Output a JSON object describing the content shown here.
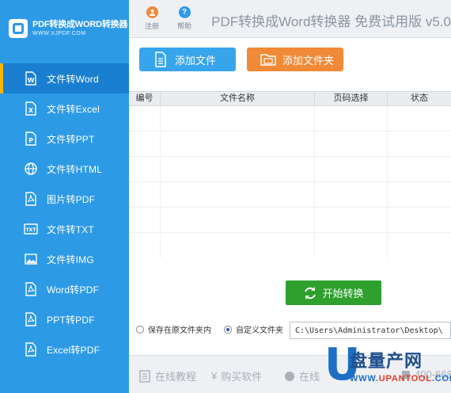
{
  "brand": {
    "title": "PDF转换成WORD转换器",
    "url": "WWW.XJPDF.COM"
  },
  "sidebar": {
    "items": [
      {
        "label": "文件转Word",
        "icon": "word-icon",
        "active": true
      },
      {
        "label": "文件转Excel",
        "icon": "excel-icon"
      },
      {
        "label": "文件转PPT",
        "icon": "ppt-icon"
      },
      {
        "label": "文件转HTML",
        "icon": "globe-icon"
      },
      {
        "label": "图片转PDF",
        "icon": "pdf-icon"
      },
      {
        "label": "文件转TXT",
        "icon": "txt-icon"
      },
      {
        "label": "文件转IMG",
        "icon": "image-icon"
      },
      {
        "label": "Word转PDF",
        "icon": "pdf-icon"
      },
      {
        "label": "PPT转PDF",
        "icon": "pdf-icon"
      },
      {
        "label": "Excel转PDF",
        "icon": "pdf-icon"
      }
    ]
  },
  "topbar": {
    "register_label": "注册",
    "help_label": "帮助",
    "title": "PDF转换成Word转换器 免费试用版 v5.0"
  },
  "toolbar": {
    "add_file_label": "添加文件",
    "add_folder_label": "添加文件夹"
  },
  "table": {
    "columns": [
      "编号",
      "文件名称",
      "页码选择",
      "状态"
    ],
    "rows": []
  },
  "actions": {
    "start_label": "开始转换"
  },
  "output": {
    "option_original": "保存在原文件夹内",
    "option_custom": "自定义文件夹",
    "selected": "custom",
    "path": "C:\\Users\\Administrator\\Desktop\\"
  },
  "footer": {
    "tutorial_label": "在线教程",
    "buy_label": "购买软件",
    "online_label": "在线",
    "phone_partial": "400-668"
  },
  "watermark": {
    "letter": "U",
    "text": "盘量产网",
    "url_prefix": "WWW.",
    "url_main": "UPANTOOL",
    "url_suffix": ".COM"
  },
  "colors": {
    "sidebar": "#2d9ae6",
    "active": "#1a7fd0",
    "add_file": "#37a5ec",
    "add_folder": "#f08a38",
    "start": "#2ea02e"
  }
}
